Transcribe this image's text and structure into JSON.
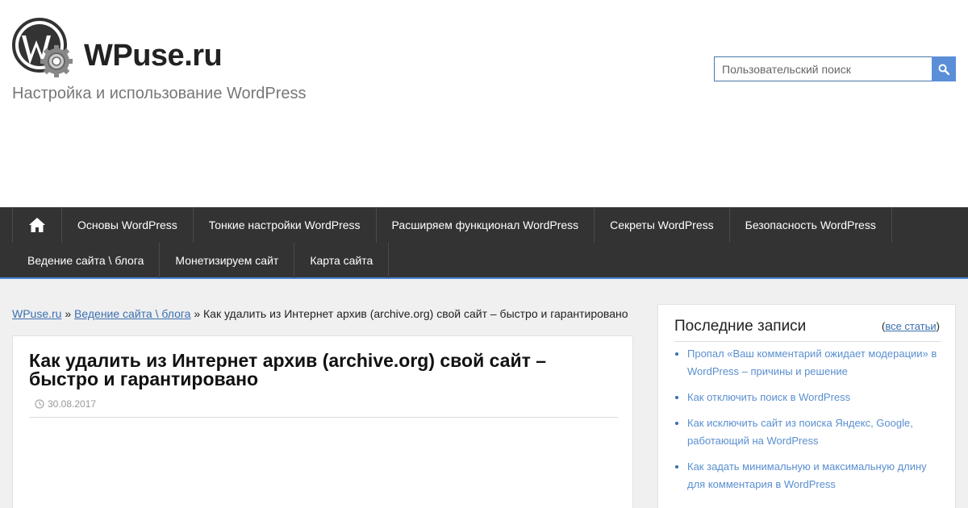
{
  "header": {
    "site_name": "WPuse.ru",
    "tagline": "Настройка и использование WordPress",
    "logo_icon": "wordpress-gear-logo"
  },
  "search": {
    "placeholder": "Пользовательский поиск",
    "button_icon": "search-icon"
  },
  "nav": {
    "home_icon": "home-icon",
    "row1": [
      "Основы WordPress",
      "Тонкие настройки WordPress",
      "Расширяем функционал WordPress",
      "Секреты WordPress",
      "Безопасность WordPress"
    ],
    "row2": [
      "Ведение сайта \\ блога",
      "Монетизируем сайт",
      "Карта сайта"
    ]
  },
  "breadcrumb": {
    "home": "WPuse.ru",
    "sep1": " » ",
    "category": "Ведение сайта \\ блога",
    "sep2": " » ",
    "current": "Как удалить из Интернет архив (archive.org) свой сайт – быстро и гарантировано"
  },
  "article": {
    "title": "Как удалить из Интернет архив (archive.org) свой сайт – быстро и гарантировано",
    "date": "30.08.2017"
  },
  "sidebar": {
    "title": "Последние записи",
    "all_open": "(",
    "all_link": "все статьи",
    "all_close": ")",
    "posts": [
      "Пропал «Ваш комментарий ожидает модерации» в WordPress – причины и решение",
      "Как отключить поиск в WordPress",
      "Как исключить сайт из поиска Яндекс, Google, работающий на WordPress",
      "Как задать минимальную и максимальную длину для комментария в WordPress"
    ]
  },
  "colors": {
    "nav_bg": "#333333",
    "accent": "#4a86d8",
    "link": "#3a6fb0"
  }
}
